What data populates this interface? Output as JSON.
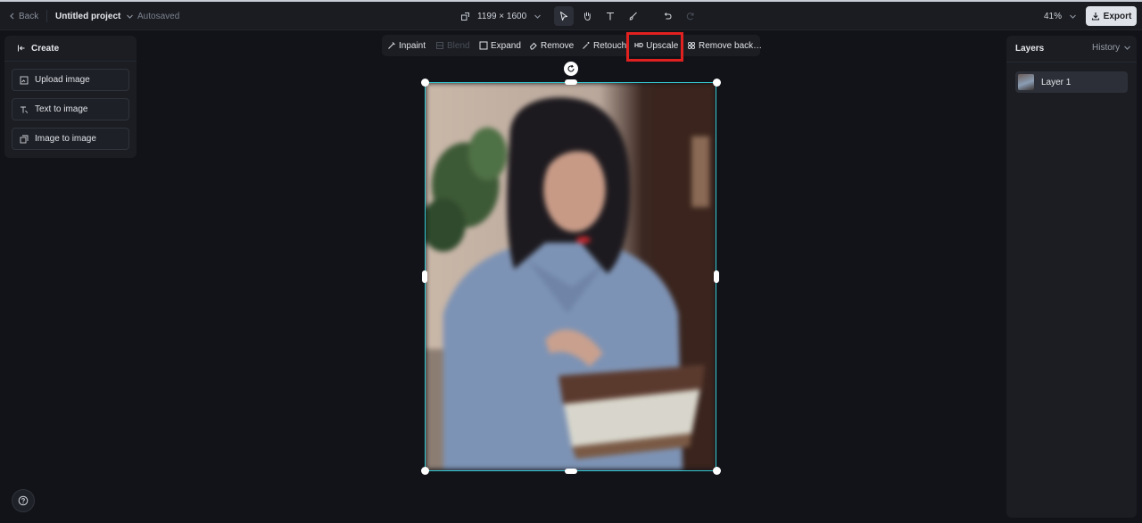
{
  "topbar": {
    "back_label": "Back",
    "project_title": "Untitled project",
    "autosaved": "Autosaved",
    "dimensions": "1199 × 1600",
    "zoom": "41%",
    "export_label": "Export"
  },
  "create_panel": {
    "title": "Create",
    "items": [
      {
        "label": "Upload image"
      },
      {
        "label": "Text to image"
      },
      {
        "label": "Image to image"
      }
    ]
  },
  "edit_toolbar": {
    "items": [
      {
        "label": "Inpaint",
        "icon": "inpaint-icon"
      },
      {
        "label": "Blend",
        "icon": "blend-icon",
        "disabled": true
      },
      {
        "label": "Expand",
        "icon": "expand-icon"
      },
      {
        "label": "Remove",
        "icon": "eraser-icon"
      },
      {
        "label": "Retouch",
        "icon": "magic-wand-icon"
      },
      {
        "label": "Upscale",
        "badge": "HD",
        "highlighted": true
      },
      {
        "label": "Remove back…",
        "icon": "remove-background-icon"
      }
    ]
  },
  "layers_panel": {
    "title": "Layers",
    "history_label": "History",
    "layers": [
      {
        "name": "Layer 1"
      }
    ]
  },
  "colors": {
    "accent_selection": "#35c9d4",
    "highlight_box": "#e0211f",
    "background": "#111318"
  }
}
